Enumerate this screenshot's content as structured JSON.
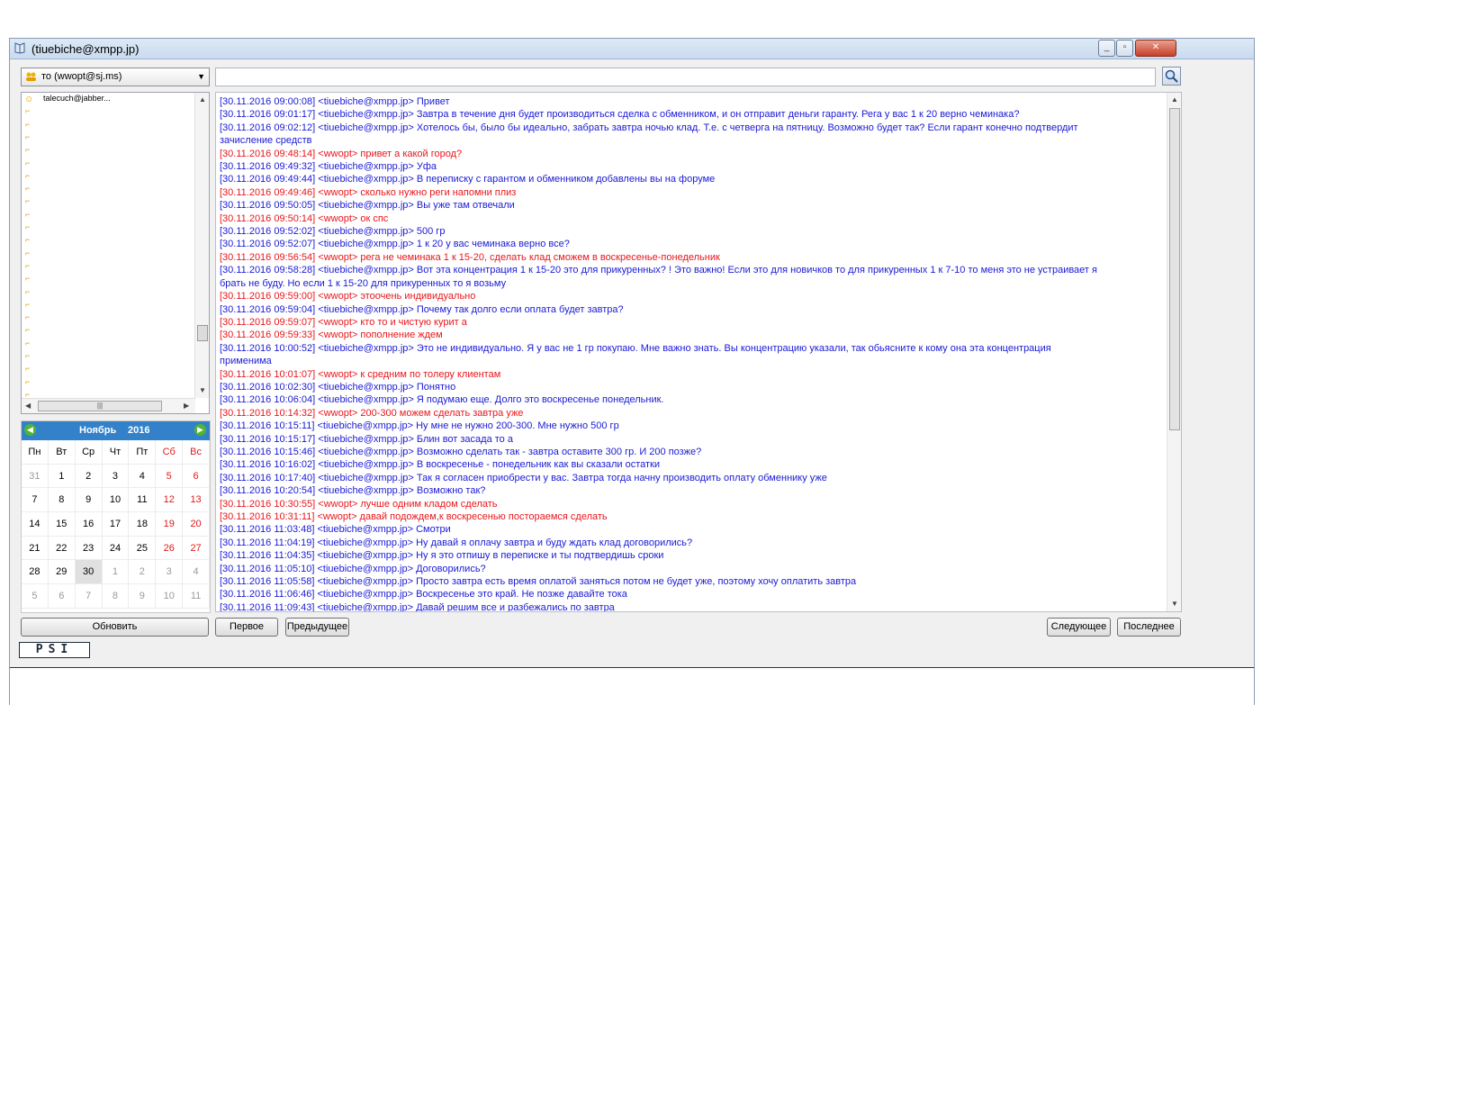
{
  "window": {
    "title": "(tiuebiche@xmpp.jp)",
    "buttons": {
      "minimize": "_",
      "restore": "▫",
      "close": "✕"
    }
  },
  "to_combo": {
    "value": "то (wwopt@sj.ms)"
  },
  "search": {
    "value": ""
  },
  "contacts": {
    "items": [
      "talecuch@jabber..."
    ]
  },
  "calendar": {
    "month": "Ноябрь",
    "year": "2016",
    "weekdays": [
      "Пн",
      "Вт",
      "Ср",
      "Чт",
      "Пт",
      "Сб",
      "Вс"
    ],
    "weeks": [
      [
        "31",
        "1",
        "2",
        "3",
        "4",
        "5",
        "6"
      ],
      [
        "7",
        "8",
        "9",
        "10",
        "11",
        "12",
        "13"
      ],
      [
        "14",
        "15",
        "16",
        "17",
        "18",
        "19",
        "20"
      ],
      [
        "21",
        "22",
        "23",
        "24",
        "25",
        "26",
        "27"
      ],
      [
        "28",
        "29",
        "30",
        "1",
        "2",
        "3",
        "4"
      ],
      [
        "5",
        "6",
        "7",
        "8",
        "9",
        "10",
        "11"
      ]
    ],
    "today": "30"
  },
  "buttons": {
    "refresh": "Обновить",
    "first": "Первое",
    "previous": "Предыдущее",
    "next": "Следующее",
    "last": "Последнее"
  },
  "logo": "PSI",
  "colors": {
    "me": "#1a1ad6",
    "them": "#e8161c",
    "calendar_header": "#3281c9"
  },
  "messages": [
    {
      "who": "me",
      "text": "[30.11.2016 09:00:08] <tiuebiche@xmpp.jp> Привет"
    },
    {
      "who": "me",
      "text": "[30.11.2016 09:01:17] <tiuebiche@xmpp.jp> Завтра в течение дня будет производиться сделка с обменником, и он отправит деньги гаранту. Рега у вас 1 к 20 верно чеминака?"
    },
    {
      "who": "me",
      "text": "[30.11.2016 09:02:12] <tiuebiche@xmpp.jp> Хотелось бы, было бы идеально, забрать завтра ночью клад. Т.е. с четверга на пятницу.  Возможно будет так? Если гарант конечно подтвердит"
    },
    {
      "who": "me",
      "text": "зачисление средств"
    },
    {
      "who": "them",
      "text": "[30.11.2016 09:48:14] <wwopt> привет а какой город?"
    },
    {
      "who": "me",
      "text": "[30.11.2016 09:49:32] <tiuebiche@xmpp.jp> Уфа"
    },
    {
      "who": "me",
      "text": "[30.11.2016 09:49:44] <tiuebiche@xmpp.jp> В переписку с гарантом и обменником добавлены вы на форуме"
    },
    {
      "who": "them",
      "text": "[30.11.2016 09:49:46] <wwopt> сколько нужно реги напомни плиз"
    },
    {
      "who": "me",
      "text": "[30.11.2016 09:50:05] <tiuebiche@xmpp.jp> Вы уже там отвечали"
    },
    {
      "who": "them",
      "text": "[30.11.2016 09:50:14] <wwopt> ок спс"
    },
    {
      "who": "me",
      "text": "[30.11.2016 09:52:02] <tiuebiche@xmpp.jp> 500 гр"
    },
    {
      "who": "me",
      "text": "[30.11.2016 09:52:07] <tiuebiche@xmpp.jp> 1 к 20 у вас чеминака верно все?"
    },
    {
      "who": "them",
      "text": "[30.11.2016 09:56:54] <wwopt> рега не чеминака 1 к 15-20, сделать клад сможем в воскресенье-понедельник"
    },
    {
      "who": "me",
      "text": "[30.11.2016 09:58:28] <tiuebiche@xmpp.jp> Вот эта концентрация 1 к 15-20 это для прикуренных? ! Это важно!  Если это для новичков то для прикуренных 1 к 7-10 то меня это не устраивает я"
    },
    {
      "who": "me",
      "text": "брать не буду. Но если 1 к 15-20 для прикуренных то я возьму"
    },
    {
      "who": "them",
      "text": "[30.11.2016 09:59:00] <wwopt> этоочень индивидуально"
    },
    {
      "who": "me",
      "text": "[30.11.2016 09:59:04] <tiuebiche@xmpp.jp> Почему так долго если оплата будет завтра?"
    },
    {
      "who": "them",
      "text": "[30.11.2016 09:59:07] <wwopt> кто то и чистую курит а"
    },
    {
      "who": "them",
      "text": "[30.11.2016 09:59:33] <wwopt> пополнение ждем"
    },
    {
      "who": "me",
      "text": "[30.11.2016 10:00:52] <tiuebiche@xmpp.jp> Это не индивидуально. Я у вас не 1 гр покупаю. Мне важно знать. Вы концентрацию указали, так обьясните к кому она эта концентрация"
    },
    {
      "who": "me",
      "text": "применима"
    },
    {
      "who": "them",
      "text": "[30.11.2016 10:01:07] <wwopt> к средним по толеру клиентам"
    },
    {
      "who": "me",
      "text": "[30.11.2016 10:02:30] <tiuebiche@xmpp.jp> Понятно"
    },
    {
      "who": "me",
      "text": "[30.11.2016 10:06:04] <tiuebiche@xmpp.jp> Я подумаю еще. Долго это воскресенье понедельник."
    },
    {
      "who": "them",
      "text": "[30.11.2016 10:14:32] <wwopt> 200-300 можем сделать завтра уже"
    },
    {
      "who": "me",
      "text": "[30.11.2016 10:15:11] <tiuebiche@xmpp.jp> Ну мне не нужно 200-300. Мне нужно 500 гр"
    },
    {
      "who": "me",
      "text": "[30.11.2016 10:15:17] <tiuebiche@xmpp.jp> Блин вот засада то а"
    },
    {
      "who": "me",
      "text": "[30.11.2016 10:15:46] <tiuebiche@xmpp.jp> Возможно сделать так - завтра оставите 300 гр. И 200 позже?"
    },
    {
      "who": "me",
      "text": "[30.11.2016 10:16:02] <tiuebiche@xmpp.jp> В воскресенье - понедельник как вы сказали остатки"
    },
    {
      "who": "me",
      "text": "[30.11.2016 10:17:40] <tiuebiche@xmpp.jp> Так я согласен приобрести у вас. Завтра тогда начну производить оплату обменнику уже"
    },
    {
      "who": "me",
      "text": "[30.11.2016 10:20:54] <tiuebiche@xmpp.jp> Возможно так?"
    },
    {
      "who": "them",
      "text": "[30.11.2016 10:30:55] <wwopt> лучше одним кладом сделать"
    },
    {
      "who": "them",
      "text": "[30.11.2016 10:31:11] <wwopt> давай подождем,к воскресенью постораемся сделать"
    },
    {
      "who": "me",
      "text": "[30.11.2016 11:03:48] <tiuebiche@xmpp.jp> Смотри"
    },
    {
      "who": "me",
      "text": "[30.11.2016 11:04:19] <tiuebiche@xmpp.jp> Ну давай я оплачу завтра и буду ждать клад договорились?"
    },
    {
      "who": "me",
      "text": "[30.11.2016 11:04:35] <tiuebiche@xmpp.jp> Ну я это отпишу в переписке и ты подтвердишь сроки"
    },
    {
      "who": "me",
      "text": "[30.11.2016 11:05:10] <tiuebiche@xmpp.jp> Договорились?"
    },
    {
      "who": "me",
      "text": "[30.11.2016 11:05:58] <tiuebiche@xmpp.jp> Просто завтра есть время оплатой заняться потом не будет уже, поэтому хочу оплатить завтра"
    },
    {
      "who": "me",
      "text": "[30.11.2016 11:06:46] <tiuebiche@xmpp.jp> Воскресенье это край. Не позже давайте тока"
    },
    {
      "who": "me",
      "text": "[30.11.2016 11:09:43] <tiuebiche@xmpp.jp> Давай решим все и разбежались по завтра"
    }
  ]
}
